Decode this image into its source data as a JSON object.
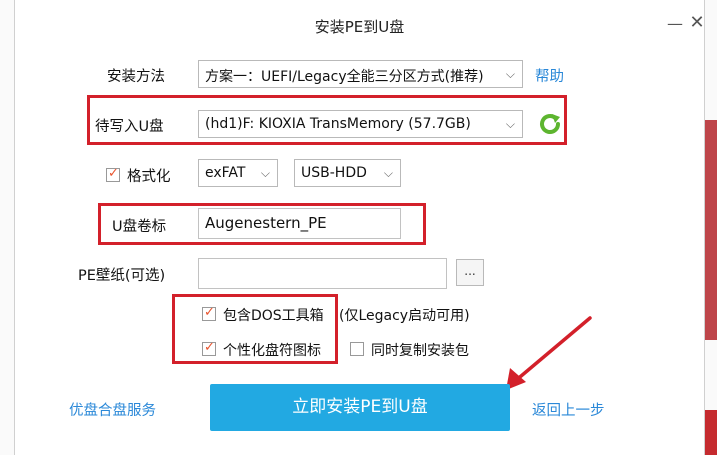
{
  "window": {
    "title": "安装PE到U盘",
    "minimize": "—",
    "close": "✕"
  },
  "install_method": {
    "label": "安装方法",
    "value": "方案一：UEFI/Legacy全能三分区方式(推荐)",
    "help": "帮助"
  },
  "target_drive": {
    "label": "待写入U盘",
    "value": "(hd1)F: KIOXIA TransMemory (57.7GB)"
  },
  "format": {
    "checked": true,
    "label": "格式化",
    "fs_value": "exFAT",
    "mode_value": "USB-HDD"
  },
  "volume_label": {
    "label": "U盘卷标",
    "value": "Augenestern_PE"
  },
  "wallpaper": {
    "label": "PE壁纸(可选)",
    "value": "",
    "browse": "..."
  },
  "options": {
    "dos_tools": {
      "checked": true,
      "label": "包含DOS工具箱",
      "note": "(仅Legacy启动可用)"
    },
    "custom_icon": {
      "checked": true,
      "label": "个性化盘符图标"
    },
    "copy_package": {
      "checked": false,
      "label": "同时复制安装包"
    }
  },
  "footer": {
    "left_link": "优盘合盘服务",
    "primary": "立即安装PE到U盘",
    "back": "返回上一步"
  },
  "colors": {
    "accent": "#22a9e2",
    "link": "#2a88d8",
    "highlight": "#d3202a",
    "refresh": "#5db52f"
  }
}
